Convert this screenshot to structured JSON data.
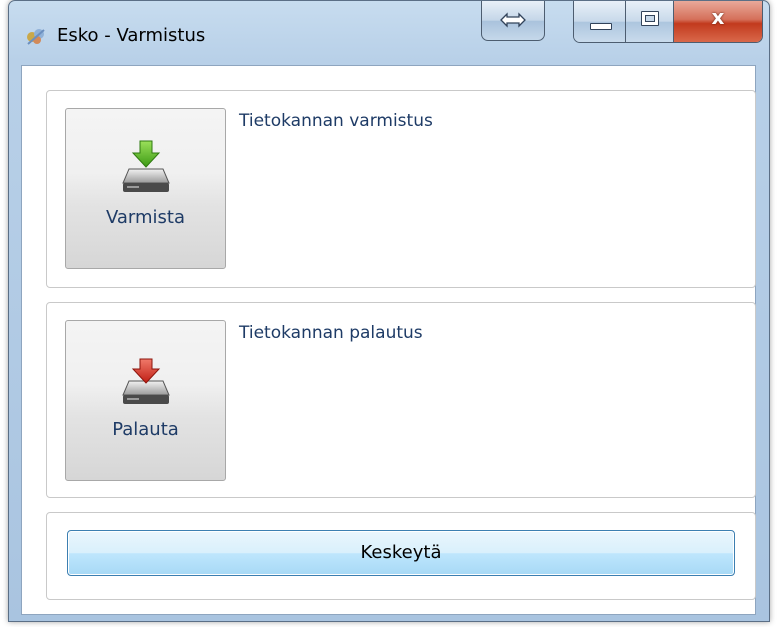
{
  "window": {
    "title": "Esko - Varmistus"
  },
  "titlebar": {
    "app_icon": "app-logo-icon",
    "snap_icon": "resize-arrows-icon",
    "minimize_icon": "minimize-icon",
    "maximize_icon": "maximize-icon",
    "close_glyph": "x"
  },
  "backup": {
    "button_label": "Varmista",
    "description": "Tietokannan varmistus",
    "icon": "drive-download-icon",
    "arrow_color": "#5fbf2a"
  },
  "restore": {
    "button_label": "Palauta",
    "description": "Tietokannan palautus",
    "icon": "drive-upload-icon",
    "arrow_color": "#d8332a"
  },
  "cancel": {
    "button_label": "Keskeytä"
  }
}
